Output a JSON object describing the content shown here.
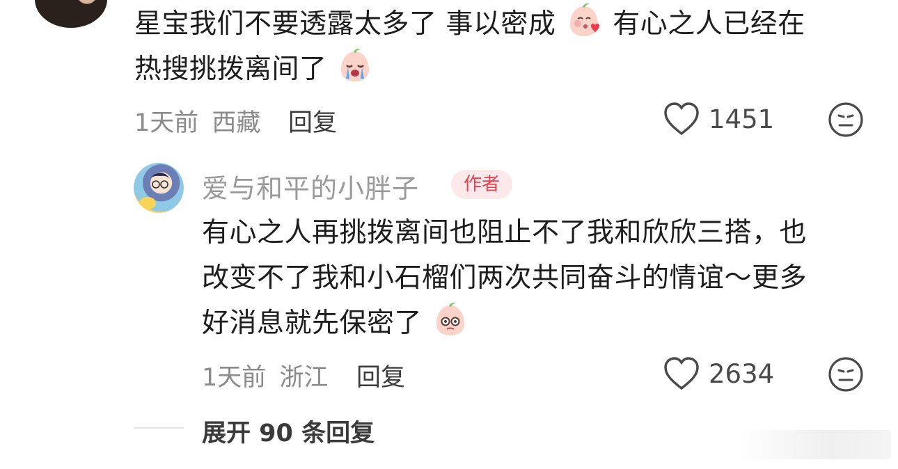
{
  "comment1": {
    "text_line1a": "星宝我们不要透露太多了 事以密成",
    "emoji1": "blushing-kiss-emoji",
    "text_line1b": "有心之人已经在",
    "text_line2": "热搜挑拨离间了",
    "emoji2": "crying-emoji",
    "time": "1天前",
    "location": "西藏",
    "reply_label": "回复",
    "like_count": "1451"
  },
  "reply1": {
    "author": "爱与和平的小胖子",
    "badge": "作者",
    "line1": "有心之人再挑拨离间也阻止不了我和欣欣三搭，也",
    "line2": "改变不了我和小石榴们两次共同奋斗的情谊～更多",
    "line3": "好消息就先保密了",
    "emoji": "nervous-eyes-emoji",
    "time": "1天前",
    "location": "浙江",
    "reply_label": "回复",
    "like_count": "2634"
  },
  "expand": {
    "label": "展开 90 条回复"
  },
  "colors": {
    "badge_text": "#e8424f",
    "badge_bg": "#fde8ea",
    "meta": "#8a8a8a"
  }
}
